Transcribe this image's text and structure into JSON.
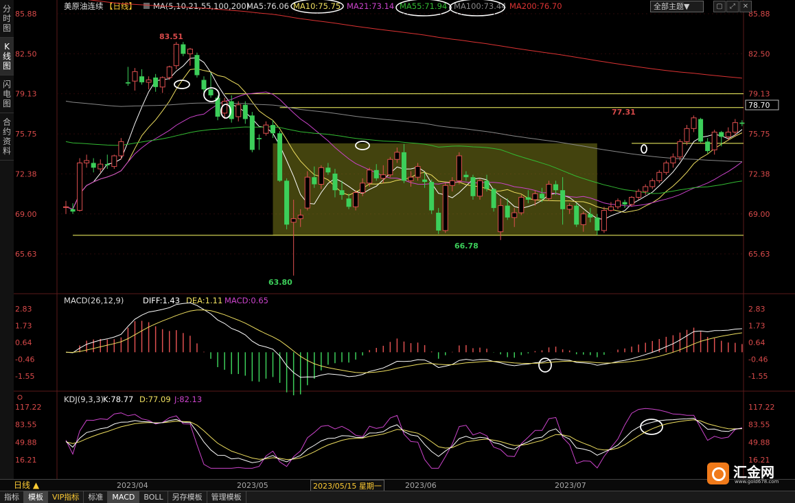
{
  "sidebar": {
    "tabs": [
      {
        "label": "分时图",
        "active": false
      },
      {
        "label": "K线图",
        "active": true
      },
      {
        "label": "闪电图",
        "active": false
      },
      {
        "label": "合约资料",
        "active": false
      }
    ]
  },
  "header": {
    "instrument": "美原油连续",
    "period": "【日线】",
    "ma_label": "MA(5,10,21,55,100,200)",
    "ma5": "MA5:76.06",
    "ma10": "MA10:75.75",
    "ma21": "MA21:73.14",
    "ma55": "MA55:71.94",
    "ma100": "MA100:73.44",
    "ma200": "MA200:76.70",
    "theme_button": "全部主题▼"
  },
  "price_axis": {
    "labels": [
      "85.88",
      "82.50",
      "79.13",
      "75.75",
      "72.38",
      "69.00",
      "65.63"
    ],
    "right_highlight": "78.70"
  },
  "annotations": {
    "high": "83.51",
    "low": "63.80",
    "box_low": "66.78",
    "recent_high": "77.31"
  },
  "macd": {
    "label": "MACD(26,12,9)",
    "diff": "DIFF:1.43",
    "dea": "DEA:1.11",
    "macd": "MACD:0.65",
    "axis": [
      "2.83",
      "1.73",
      "0.64",
      "-0.46",
      "-1.55"
    ]
  },
  "kdj": {
    "label": "KDJ(9,3,3)",
    "k": "K:78.77",
    "d": "D:77.09",
    "j": "J:82.13",
    "axis": [
      "117.22",
      "83.55",
      "49.88",
      "16.21"
    ]
  },
  "timeline": {
    "period": "日线 ▲",
    "months": [
      "2023/04",
      "2023/05",
      "2023/06",
      "2023/07"
    ],
    "cursor_date": "2023/05/15 星期一"
  },
  "bottom_tabs": [
    {
      "label": "指标",
      "active": false
    },
    {
      "label": "模板",
      "active": true
    },
    {
      "label": "VIP指标",
      "active": false,
      "vip": true
    },
    {
      "label": "标准",
      "active": false
    },
    {
      "label": "MACD",
      "active": true
    },
    {
      "label": "BOLL",
      "active": false
    },
    {
      "label": "另存模板",
      "active": false
    },
    {
      "label": "管理模板",
      "active": false
    }
  ],
  "logo": {
    "name": "汇金网",
    "url": "www.gold678.com"
  },
  "colors": {
    "up": "#e05050",
    "down": "#3ccf5a",
    "ma5": "#ffffff",
    "ma10": "#f0e060",
    "ma21": "#cc44cc",
    "ma55": "#33bb33",
    "ma100": "#888888",
    "ma200": "#dd3333",
    "axis_text": "#d94a4a"
  },
  "chart_data": {
    "type": "candlestick",
    "x_months": [
      "2023/04",
      "2023/05",
      "2023/06",
      "2023/07"
    ],
    "y_axis": [
      65.63,
      69.0,
      72.38,
      75.75,
      79.13,
      82.5,
      85.88
    ],
    "candles": [
      [
        69.6,
        70.1,
        69.0,
        69.6
      ],
      [
        69.4,
        69.9,
        69.0,
        69.2
      ],
      [
        69.3,
        73.7,
        69.2,
        73.3
      ],
      [
        73.3,
        74.0,
        72.9,
        73.5
      ],
      [
        73.3,
        73.7,
        72.5,
        72.9
      ],
      [
        72.8,
        73.6,
        72.5,
        73.2
      ],
      [
        73.2,
        74.0,
        72.8,
        73.1
      ],
      [
        73.0,
        74.0,
        72.8,
        73.9
      ],
      [
        73.9,
        75.4,
        73.6,
        75.1
      ],
      [
        80.1,
        81.4,
        79.8,
        80.0
      ],
      [
        80.2,
        81.3,
        79.4,
        81.0
      ],
      [
        80.6,
        81.2,
        79.9,
        80.1
      ],
      [
        80.1,
        80.6,
        79.5,
        80.3
      ],
      [
        80.5,
        80.8,
        79.3,
        79.7
      ],
      [
        79.7,
        80.6,
        79.2,
        80.5
      ],
      [
        80.5,
        81.5,
        80.3,
        81.4
      ],
      [
        81.5,
        83.5,
        81.2,
        83.3
      ],
      [
        83.3,
        83.5,
        82.3,
        82.5
      ],
      [
        82.5,
        83.0,
        81.5,
        82.9
      ],
      [
        82.4,
        82.6,
        80.5,
        80.7
      ],
      [
        80.3,
        80.6,
        79.0,
        79.5
      ],
      [
        79.5,
        80.9,
        78.8,
        79.0
      ],
      [
        78.8,
        79.0,
        76.9,
        77.2
      ],
      [
        77.5,
        78.8,
        77.0,
        78.5
      ],
      [
        78.5,
        79.0,
        76.7,
        77.0
      ],
      [
        77.2,
        78.5,
        76.8,
        78.2
      ],
      [
        78.2,
        78.5,
        76.6,
        77.0
      ],
      [
        77.3,
        77.6,
        74.2,
        74.4
      ],
      [
        75.4,
        75.7,
        74.4,
        75.3
      ],
      [
        75.8,
        76.8,
        75.6,
        76.5
      ],
      [
        76.5,
        76.9,
        75.4,
        75.8
      ],
      [
        75.8,
        76.0,
        71.7,
        71.8
      ],
      [
        71.8,
        72.0,
        67.7,
        68.1
      ],
      [
        68.3,
        70.2,
        63.8,
        68.6
      ],
      [
        68.6,
        69.4,
        67.9,
        68.9
      ],
      [
        69.5,
        72.6,
        69.3,
        72.1
      ],
      [
        72.1,
        73.0,
        71.2,
        71.5
      ],
      [
        71.5,
        73.1,
        71.1,
        72.9
      ],
      [
        72.9,
        73.3,
        72.3,
        72.5
      ],
      [
        72.4,
        72.8,
        70.4,
        71.0
      ],
      [
        71.0,
        71.8,
        70.2,
        70.6
      ],
      [
        70.3,
        70.7,
        69.4,
        69.6
      ],
      [
        69.6,
        71.0,
        69.3,
        70.8
      ],
      [
        70.8,
        72.0,
        70.5,
        71.6
      ],
      [
        71.6,
        72.9,
        71.3,
        72.7
      ],
      [
        72.7,
        73.2,
        71.8,
        72.0
      ],
      [
        72.0,
        73.1,
        71.6,
        72.3
      ],
      [
        72.3,
        73.8,
        72.1,
        73.6
      ],
      [
        73.6,
        74.6,
        73.3,
        74.2
      ],
      [
        74.2,
        74.9,
        71.6,
        71.8
      ],
      [
        71.8,
        72.6,
        71.3,
        72.1
      ],
      [
        72.1,
        73.3,
        71.8,
        73.0
      ],
      [
        71.9,
        72.5,
        71.2,
        71.7
      ],
      [
        71.7,
        71.9,
        69.0,
        69.3
      ],
      [
        69.1,
        69.5,
        67.3,
        67.6
      ],
      [
        67.6,
        71.6,
        67.4,
        71.4
      ],
      [
        71.4,
        72.1,
        70.9,
        71.8
      ],
      [
        71.8,
        74.2,
        71.5,
        73.9
      ],
      [
        72.3,
        72.6,
        71.8,
        72.1
      ],
      [
        72.1,
        72.3,
        70.2,
        70.5
      ],
      [
        70.5,
        72.0,
        70.2,
        71.8
      ],
      [
        71.8,
        72.3,
        70.9,
        71.1
      ],
      [
        71.1,
        71.2,
        69.2,
        69.5
      ],
      [
        67.5,
        70.3,
        66.8,
        69.7
      ],
      [
        69.7,
        70.3,
        68.5,
        68.7
      ],
      [
        68.7,
        69.5,
        67.9,
        69.1
      ],
      [
        69.1,
        70.6,
        68.9,
        70.4
      ],
      [
        70.4,
        71.0,
        69.9,
        70.2
      ],
      [
        70.2,
        71.0,
        69.7,
        70.7
      ],
      [
        70.7,
        71.2,
        70.0,
        70.3
      ],
      [
        70.3,
        71.8,
        70.1,
        71.5
      ],
      [
        71.5,
        71.8,
        70.6,
        71.0
      ],
      [
        71.0,
        72.1,
        68.1,
        69.4
      ],
      [
        69.4,
        69.9,
        69.0,
        69.7
      ],
      [
        69.7,
        69.9,
        67.9,
        68.1
      ],
      [
        68.1,
        69.2,
        67.5,
        69.0
      ],
      [
        69.0,
        69.5,
        68.3,
        68.7
      ],
      [
        68.7,
        69.0,
        67.2,
        67.6
      ],
      [
        67.6,
        69.6,
        67.4,
        69.3
      ],
      [
        69.3,
        70.0,
        69.2,
        69.6
      ],
      [
        69.6,
        70.3,
        69.4,
        70.1
      ],
      [
        70.0,
        70.2,
        69.5,
        69.8
      ],
      [
        69.8,
        70.5,
        69.6,
        70.4
      ],
      [
        70.4,
        71.1,
        70.2,
        70.9
      ],
      [
        70.9,
        71.5,
        70.6,
        71.3
      ],
      [
        71.3,
        72.0,
        71.1,
        71.8
      ],
      [
        71.8,
        72.7,
        71.6,
        72.5
      ],
      [
        72.5,
        73.5,
        72.3,
        73.3
      ],
      [
        73.3,
        74.1,
        72.9,
        73.8
      ],
      [
        73.8,
        75.3,
        73.5,
        75.1
      ],
      [
        75.1,
        76.5,
        74.8,
        76.2
      ],
      [
        76.2,
        77.3,
        75.9,
        77.1
      ],
      [
        77.0,
        77.1,
        75.0,
        75.1
      ],
      [
        75.1,
        75.4,
        74.1,
        74.3
      ],
      [
        74.4,
        76.1,
        74.0,
        75.9
      ],
      [
        75.9,
        76.0,
        74.7,
        75.5
      ],
      [
        75.5,
        76.3,
        75.2,
        75.9
      ],
      [
        75.9,
        77.0,
        75.6,
        76.7
      ],
      [
        76.7,
        76.9,
        76.4,
        76.6
      ]
    ],
    "horizontal_lines": [
      79.13,
      77.97,
      74.95,
      67.2
    ],
    "consolidation_box": {
      "y_low": 67.2,
      "y_high": 74.95
    },
    "macd": {
      "diff": 1.43,
      "dea": 1.11,
      "hist": 0.65
    },
    "kdj": {
      "k": 78.77,
      "d": 77.09,
      "j": 82.13
    }
  }
}
